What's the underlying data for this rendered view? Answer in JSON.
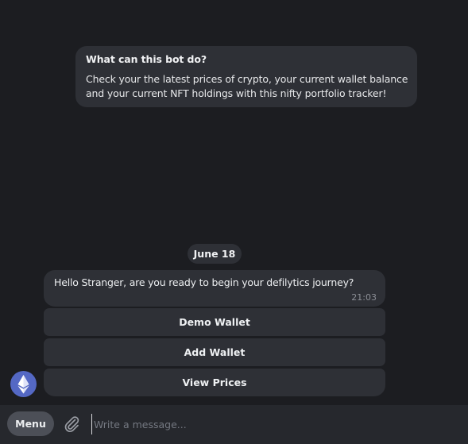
{
  "bot_info": {
    "title": "What can this bot do?",
    "description_line1": "Check your the latest prices of crypto, your current wallet balance",
    "description_line2": "and your current NFT holdings with this nifty portfolio tracker!"
  },
  "date_separator": "June 18",
  "message": {
    "text": "Hello Stranger, are you ready to begin your defilytics journey?",
    "time": "21:03"
  },
  "keyboard": {
    "buttons": [
      "Demo Wallet",
      "Add Wallet",
      "View Prices"
    ]
  },
  "avatar": {
    "icon": "ethereum-icon",
    "color": "#5468c4"
  },
  "composer": {
    "menu_label": "Menu",
    "attach_icon": "paperclip-icon",
    "placeholder": "Write a message..."
  },
  "colors": {
    "background": "#1c1d21",
    "bubble": "#2e3036",
    "composer": "#26282d",
    "menu_button": "#4c4f57"
  }
}
